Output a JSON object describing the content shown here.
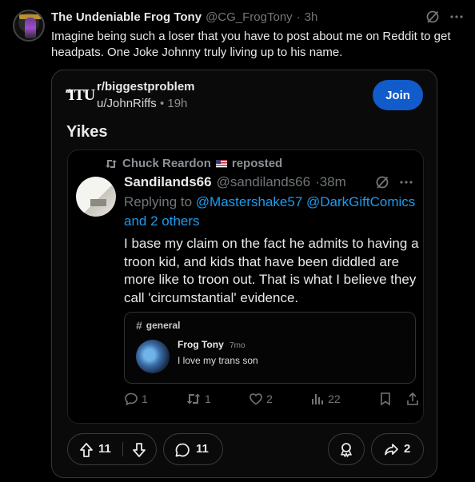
{
  "tweet": {
    "display_name": "The Undeniable Frog Tony",
    "handle": "@CG_FrogTony",
    "separator": "·",
    "time": "3h",
    "text": "Imagine being such a loser that you have to post about me on Reddit to get headpats. One Joke Johnny truly living up to his name."
  },
  "reddit_card": {
    "subreddit": "r/biggestproblem",
    "logo_text": "ΊTU",
    "logo_small": "aff",
    "user": "u/JohnRiffs",
    "separator": "•",
    "time": "19h",
    "join_label": "Join",
    "title": "Yikes",
    "embedded_tweet": {
      "repost_by": "Chuck Reardon",
      "repost_suffix": "reposted",
      "display_name": "Sandilands66",
      "handle": "@sandilands66",
      "time": "·38m",
      "reply_prefix": "Replying to",
      "reply_mentions": "@Mastershake57 @DarkGiftComics",
      "reply_others": "and 2 others",
      "body": "I base my claim on the fact he admits to having a troon kid, and kids that have been diddled are more like to troon out. That is what I believe they call 'circumstantial' evidence.",
      "discord": {
        "channel": "general",
        "author": "Frog Tony",
        "when": "7mo",
        "message": "I love my trans son"
      },
      "actions": {
        "replies": "1",
        "reposts": "1",
        "likes": "2",
        "views": "22"
      }
    },
    "bottom": {
      "upvotes": "11",
      "comments": "11",
      "shares": "2"
    }
  },
  "colors": {
    "link": "#1d9bf0",
    "join_button": "#115bca",
    "muted": "#71767b"
  }
}
